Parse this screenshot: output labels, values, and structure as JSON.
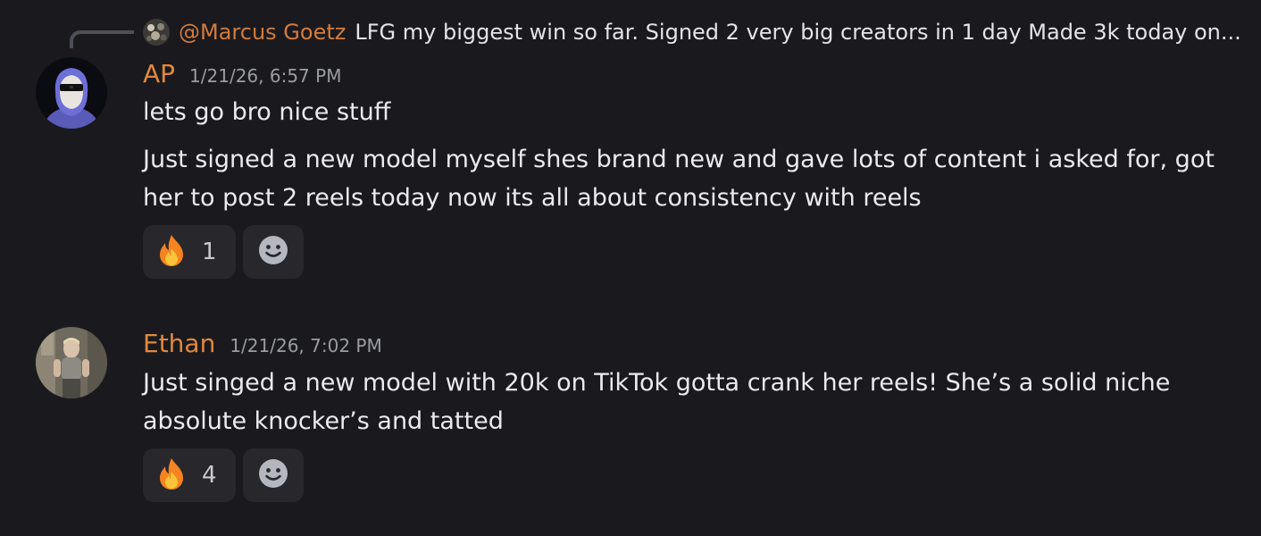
{
  "reply": {
    "author": "@Marcus Goetz",
    "text": "LFG my biggest win so far. Signed 2 very big creators in 1 day Made 3k today on..."
  },
  "messages": [
    {
      "author": "AP",
      "timestamp": "1/21/26, 6:57 PM",
      "lines": [
        "lets go bro nice stuff",
        "Just signed a new model myself shes brand new and gave lots of content i asked for, got",
        "her to post 2 reels today now its all about consistency with reels"
      ],
      "reaction": {
        "emoji": "fire-emoji",
        "count": "1"
      }
    },
    {
      "author": "Ethan",
      "timestamp": "1/21/26, 7:02 PM",
      "lines": [
        "Just singed a new model with 20k on TikTok gotta crank her reels! She’s a solid niche",
        "absolute knocker’s and tatted"
      ],
      "reaction": {
        "emoji": "fire-emoji",
        "count": "4"
      }
    }
  ],
  "colors": {
    "background": "#1a1a1e",
    "author": "#e0883e",
    "text": "#ebebef",
    "timestamp": "#9a9ca4",
    "reaction_bg": "#27272c"
  }
}
